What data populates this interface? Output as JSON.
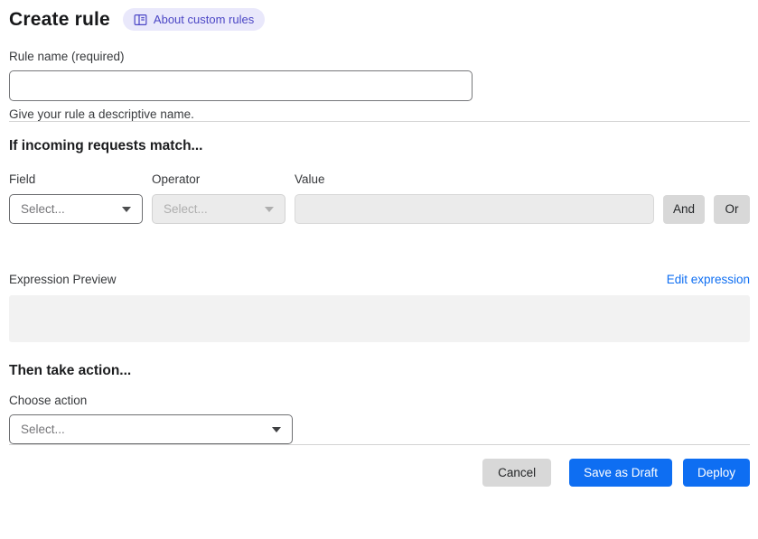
{
  "header": {
    "title": "Create rule",
    "about_link": "About custom rules"
  },
  "rule_name": {
    "label": "Rule name (required)",
    "value": "",
    "helper": "Give your rule a descriptive name."
  },
  "match": {
    "heading": "If incoming requests match...",
    "field_label": "Field",
    "operator_label": "Operator",
    "value_label": "Value",
    "field_value": "Select...",
    "operator_value": "Select...",
    "value_value": "",
    "and_label": "And",
    "or_label": "Or",
    "expression_preview_label": "Expression Preview",
    "edit_expression_link": "Edit expression",
    "expression_value": ""
  },
  "action": {
    "heading": "Then take action...",
    "label": "Choose action",
    "value": "Select..."
  },
  "footer": {
    "cancel": "Cancel",
    "save_draft": "Save as Draft",
    "deploy": "Deploy"
  },
  "colors": {
    "accent_blue": "#0e6ef2",
    "badge_bg": "#e9e8fb",
    "badge_text": "#4b46c5",
    "disabled_bg": "#ebebeb",
    "neutral_button_bg": "#d8d8d8",
    "preview_bg": "#f2f2f2",
    "divider": "#d4d4d4"
  },
  "icons": {
    "about_custom_rules": "book-icon",
    "select_dropdown": "chevron-down-icon"
  }
}
